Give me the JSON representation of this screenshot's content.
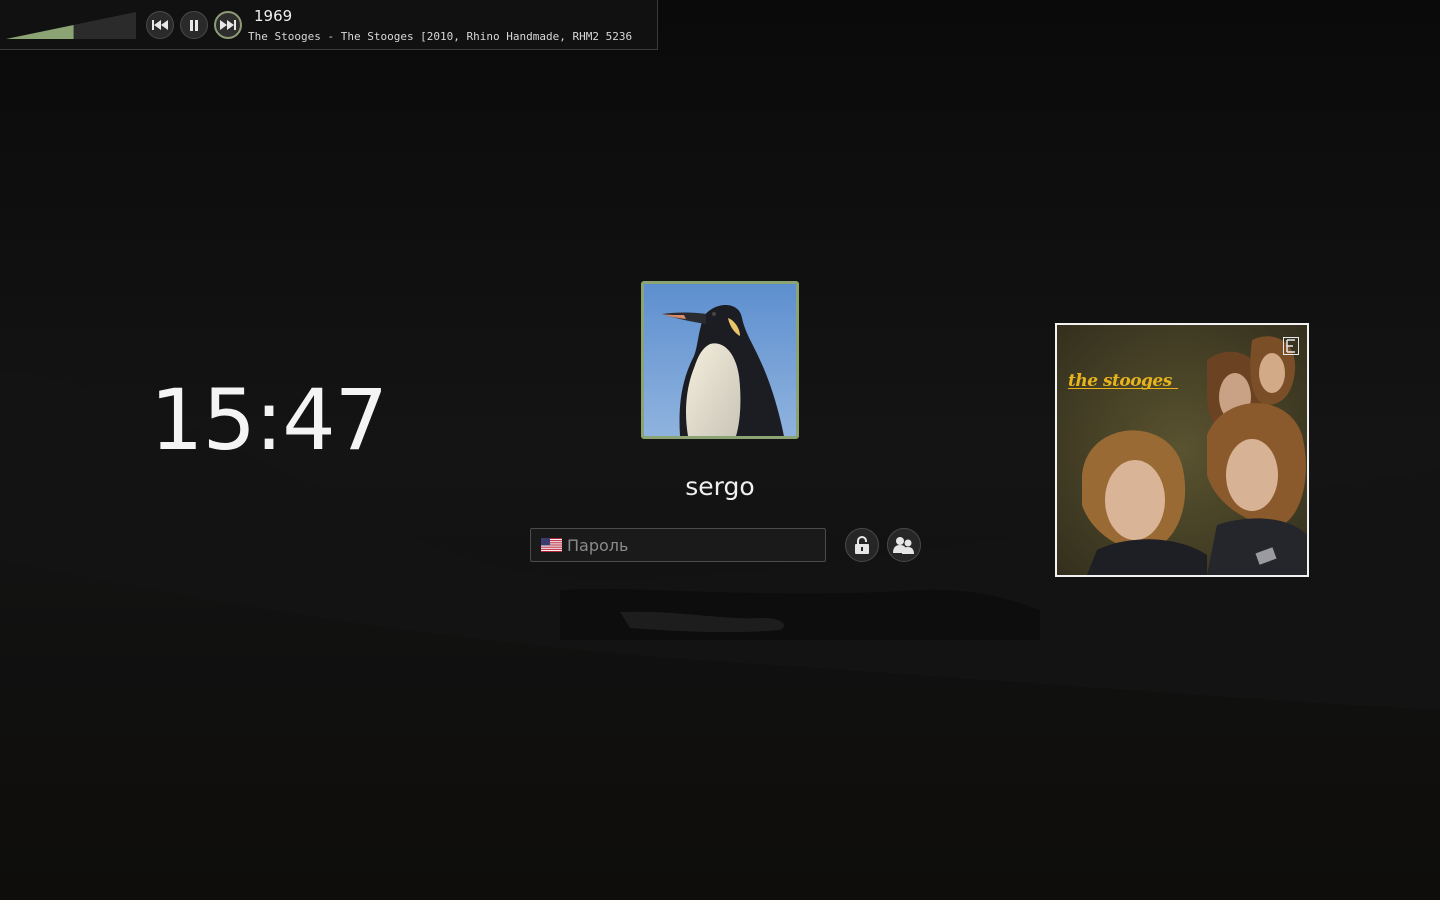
{
  "player": {
    "title": "1969",
    "info": "The Stooges - The Stooges [2010, Rhino Handmade, RHM2 5236",
    "volume": 0.52,
    "accent": "#8ca474"
  },
  "clock": {
    "time": "15:47"
  },
  "user": {
    "name": "sergo"
  },
  "login": {
    "password_placeholder": "Пароль",
    "keyboard_layout": "us"
  },
  "album": {
    "brand_text": "the stooges"
  },
  "icons": {
    "prev": "skip-back-icon",
    "pause": "pause-icon",
    "next": "skip-forward-icon",
    "unlock": "padlock-icon",
    "users": "switch-user-icon"
  }
}
